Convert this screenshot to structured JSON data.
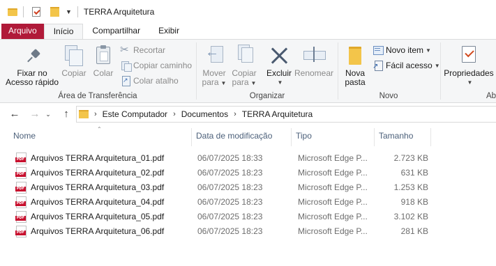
{
  "window": {
    "title": "TERRA Arquitetura"
  },
  "tabs": [
    {
      "label": "Arquivo"
    },
    {
      "label": "Início"
    },
    {
      "label": "Compartilhar"
    },
    {
      "label": "Exibir"
    }
  ],
  "ribbon": {
    "clipboard": {
      "pin_line1": "Fixar no",
      "pin_line2": "Acesso rápido",
      "copy": "Copiar",
      "paste": "Colar",
      "cut": "Recortar",
      "copy_path": "Copiar caminho",
      "paste_shortcut": "Colar atalho",
      "group_label": "Área de Transferência"
    },
    "organize": {
      "move_line1": "Mover",
      "move_line2": "para",
      "copyto_line1": "Copiar",
      "copyto_line2": "para",
      "delete": "Excluir",
      "rename": "Renomear",
      "group_label": "Organizar"
    },
    "new": {
      "new_folder_line1": "Nova",
      "new_folder_line2": "pasta",
      "new_item": "Novo item",
      "easy_access": "Fácil acesso",
      "group_label": "Novo"
    },
    "open": {
      "properties": "Propriedades",
      "group_label_partial": "Ab"
    }
  },
  "address": {
    "crumbs": [
      "Este Computador",
      "Documentos",
      "TERRA Arquitetura"
    ]
  },
  "columns": {
    "name": "Nome",
    "date": "Data de modificação",
    "type": "Tipo",
    "size": "Tamanho"
  },
  "files": [
    {
      "name": "Arquivos TERRA Arquitetura_01.pdf",
      "date": "06/07/2025 18:33",
      "type": "Microsoft Edge P...",
      "size": "2.723 KB"
    },
    {
      "name": "Arquivos TERRA Arquitetura_02.pdf",
      "date": "06/07/2025 18:23",
      "type": "Microsoft Edge P...",
      "size": "631 KB"
    },
    {
      "name": "Arquivos TERRA Arquitetura_03.pdf",
      "date": "06/07/2025 18:23",
      "type": "Microsoft Edge P...",
      "size": "1.253 KB"
    },
    {
      "name": "Arquivos TERRA Arquitetura_04.pdf",
      "date": "06/07/2025 18:23",
      "type": "Microsoft Edge P...",
      "size": "918 KB"
    },
    {
      "name": "Arquivos TERRA Arquitetura_05.pdf",
      "date": "06/07/2025 18:23",
      "type": "Microsoft Edge P...",
      "size": "3.102 KB"
    },
    {
      "name": "Arquivos TERRA Arquitetura_06.pdf",
      "date": "06/07/2025 18:23",
      "type": "Microsoft Edge P...",
      "size": "281 KB"
    }
  ],
  "icon_labels": {
    "pdf": "PDF"
  }
}
